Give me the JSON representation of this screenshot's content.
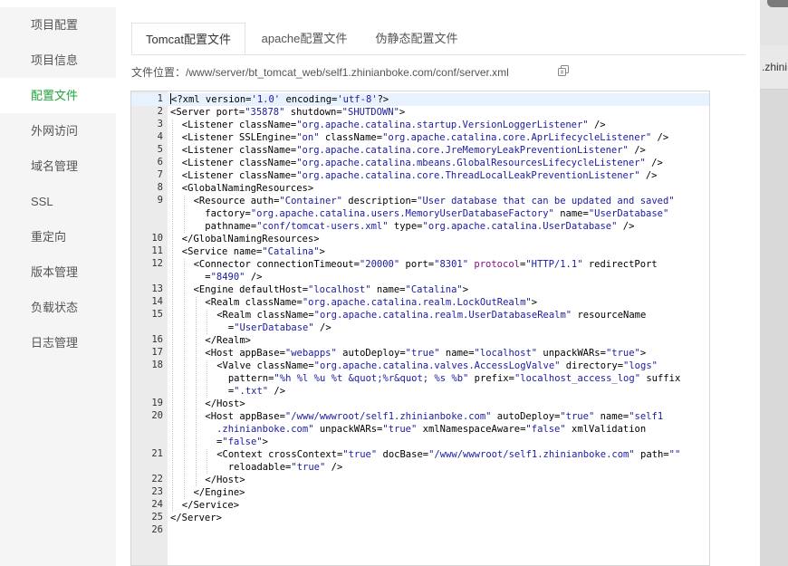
{
  "background": {
    "partial_text": ".zhini"
  },
  "sidebar": {
    "items": [
      {
        "label": "项目配置",
        "name": "sidebar-item-project-config",
        "active": false
      },
      {
        "label": "项目信息",
        "name": "sidebar-item-project-info",
        "active": false
      },
      {
        "label": "配置文件",
        "name": "sidebar-item-config-file",
        "active": true
      },
      {
        "label": "外网访问",
        "name": "sidebar-item-external-access",
        "active": false
      },
      {
        "label": "域名管理",
        "name": "sidebar-item-domain",
        "active": false
      },
      {
        "label": "SSL",
        "name": "sidebar-item-ssl",
        "active": false
      },
      {
        "label": "重定向",
        "name": "sidebar-item-redirect",
        "active": false
      },
      {
        "label": "版本管理",
        "name": "sidebar-item-version",
        "active": false
      },
      {
        "label": "负载状态",
        "name": "sidebar-item-load-status",
        "active": false
      },
      {
        "label": "日志管理",
        "name": "sidebar-item-logs",
        "active": false
      }
    ]
  },
  "tabs": [
    {
      "label": "Tomcat配置文件",
      "active": true
    },
    {
      "label": "apache配置文件",
      "active": false
    },
    {
      "label": "伪静态配置文件",
      "active": false
    }
  ],
  "file": {
    "label": "文件位置：",
    "path": "/www/server/bt_tomcat_web/self1.zhinianboke.com/conf/server.xml"
  },
  "editor": {
    "accent_color": "#20a53a",
    "lines": [
      {
        "n": "1",
        "indent": 0,
        "html": "<?xml version=<span class=\"s\">'1.0'</span> encoding=<span class=\"s\">'utf-8'</span>?>"
      },
      {
        "n": "2",
        "indent": 0,
        "html": "<Server port=<span class=\"s\">\"35878\"</span> shutdown=<span class=\"s\">\"SHUTDOWN\"</span>>"
      },
      {
        "n": "3",
        "indent": 1,
        "html": "<Listener className=<span class=\"s\">\"org.apache.catalina.startup.VersionLoggerListener\"</span> />"
      },
      {
        "n": "4",
        "indent": 1,
        "html": "<Listener SSLEngine=<span class=\"s\">\"on\"</span> className=<span class=\"s\">\"org.apache.catalina.core.AprLifecycleListener\"</span> />"
      },
      {
        "n": "5",
        "indent": 1,
        "html": "<Listener className=<span class=\"s\">\"org.apache.catalina.core.JreMemoryLeakPreventionListener\"</span> />"
      },
      {
        "n": "6",
        "indent": 1,
        "html": "<Listener className=<span class=\"s\">\"org.apache.catalina.mbeans.GlobalResourcesLifecycleListener\"</span> />"
      },
      {
        "n": "7",
        "indent": 1,
        "html": "<Listener className=<span class=\"s\">\"org.apache.catalina.core.ThreadLocalLeakPreventionListener\"</span> />"
      },
      {
        "n": "8",
        "indent": 1,
        "html": "<GlobalNamingResources>"
      },
      {
        "n": "9",
        "indent": 2,
        "html": "<Resource auth=<span class=\"s\">\"Container\"</span> description=<span class=\"s\">\"User database that can be updated and saved\"</span>\n  factory=<span class=\"s\">\"org.apache.catalina.users.MemoryUserDatabaseFactory\"</span> name=<span class=\"s\">\"UserDatabase\"</span>\n  pathname=<span class=\"s\">\"conf/tomcat-users.xml\"</span> type=<span class=\"s\">\"org.apache.catalina.UserDatabase\"</span> />"
      },
      {
        "n": "10",
        "indent": 1,
        "html": "</GlobalNamingResources>"
      },
      {
        "n": "11",
        "indent": 1,
        "html": "<Service name=<span class=\"s\">\"Catalina\"</span>>"
      },
      {
        "n": "12",
        "indent": 2,
        "html": "<Connector connectionTimeout=<span class=\"s\">\"20000\"</span> port=<span class=\"s\">\"8301\"</span> <span class=\"kw\">protocol</span>=<span class=\"s\">\"HTTP/1.1\"</span> redirectPort\n  =<span class=\"s\">\"8490\"</span> />"
      },
      {
        "n": "13",
        "indent": 2,
        "html": "<Engine defaultHost=<span class=\"s\">\"localhost\"</span> name=<span class=\"s\">\"Catalina\"</span>>"
      },
      {
        "n": "14",
        "indent": 3,
        "html": "<Realm className=<span class=\"s\">\"org.apache.catalina.realm.LockOutRealm\"</span>>"
      },
      {
        "n": "15",
        "indent": 4,
        "html": "<Realm className=<span class=\"s\">\"org.apache.catalina.realm.UserDatabaseRealm\"</span> resourceName\n  =<span class=\"s\">\"UserDatabase\"</span> />"
      },
      {
        "n": "16",
        "indent": 3,
        "html": "</Realm>"
      },
      {
        "n": "17",
        "indent": 3,
        "html": "<Host appBase=<span class=\"s\">\"webapps\"</span> autoDeploy=<span class=\"s\">\"true\"</span> name=<span class=\"s\">\"localhost\"</span> unpackWARs=<span class=\"s\">\"true\"</span>>"
      },
      {
        "n": "18",
        "indent": 4,
        "html": "<Valve className=<span class=\"s\">\"org.apache.catalina.valves.AccessLogValve\"</span> directory=<span class=\"s\">\"logs\"</span>\n  pattern=<span class=\"s\">\"%h %l %u %t &amp;quot;%r&amp;quot; %s %b\"</span> prefix=<span class=\"s\">\"localhost_access_log\"</span> suffix\n  =<span class=\"s\">\".txt\"</span> />"
      },
      {
        "n": "19",
        "indent": 3,
        "html": "</Host>"
      },
      {
        "n": "20",
        "indent": 3,
        "html": "<Host appBase=<span class=\"s\">\"/www/wwwroot/self1.zhinianboke.com\"</span> autoDeploy=<span class=\"s\">\"true\"</span> name=<span class=\"s\">\"self1\n  .zhinianboke.com\"</span> unpackWARs=<span class=\"s\">\"true\"</span> xmlNamespaceAware=<span class=\"s\">\"false\"</span> xmlValidation\n  =<span class=\"s\">\"false\"</span>>"
      },
      {
        "n": "21",
        "indent": 4,
        "html": "<Context crossContext=<span class=\"s\">\"true\"</span> docBase=<span class=\"s\">\"/www/wwwroot/self1.zhinianboke.com\"</span> path=<span class=\"s\">\"\"</span>\n  reloadable=<span class=\"s\">\"true\"</span> />"
      },
      {
        "n": "22",
        "indent": 3,
        "html": "</Host>"
      },
      {
        "n": "23",
        "indent": 2,
        "html": "</Engine>"
      },
      {
        "n": "24",
        "indent": 1,
        "html": "</Service>"
      },
      {
        "n": "25",
        "indent": 0,
        "html": "</Server>"
      },
      {
        "n": "26",
        "indent": 0,
        "html": ""
      }
    ]
  }
}
